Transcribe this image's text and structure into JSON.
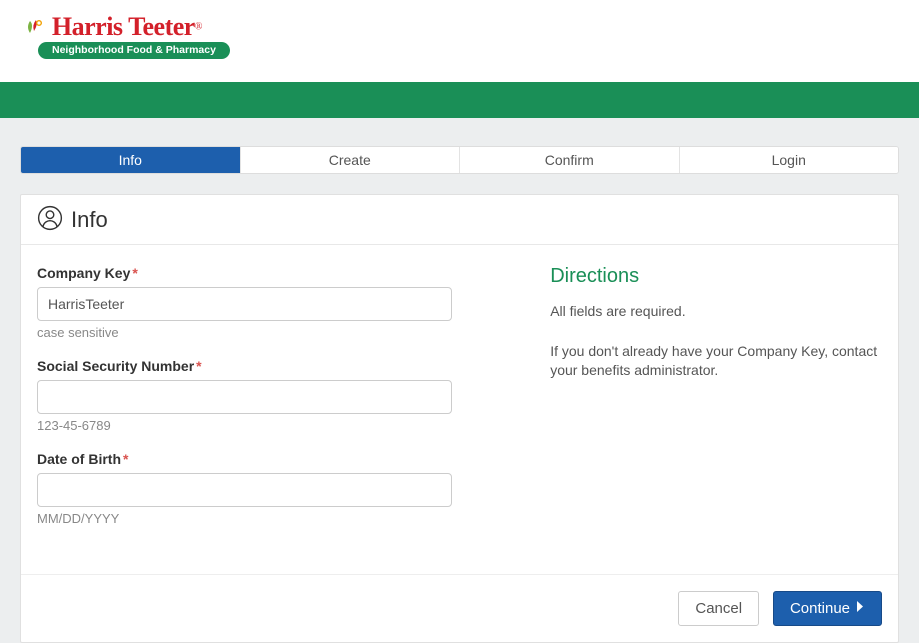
{
  "logo": {
    "brand": "Harris Teeter",
    "tagline": "Neighborhood Food & Pharmacy"
  },
  "tabs": {
    "info": "Info",
    "create": "Create",
    "confirm": "Confirm",
    "login": "Login"
  },
  "panel": {
    "title": "Info"
  },
  "form": {
    "company_key": {
      "label": "Company Key",
      "value": "HarrisTeeter",
      "help": "case sensitive"
    },
    "ssn": {
      "label": "Social Security Number",
      "value": "",
      "help": "123-45-6789"
    },
    "dob": {
      "label": "Date of Birth",
      "value": "",
      "help": "MM/DD/YYYY"
    }
  },
  "directions": {
    "title": "Directions",
    "line1": "All fields are required.",
    "line2": "If you don't already have your Company Key, contact your benefits administrator."
  },
  "footer": {
    "cancel": "Cancel",
    "continue": "Continue"
  }
}
